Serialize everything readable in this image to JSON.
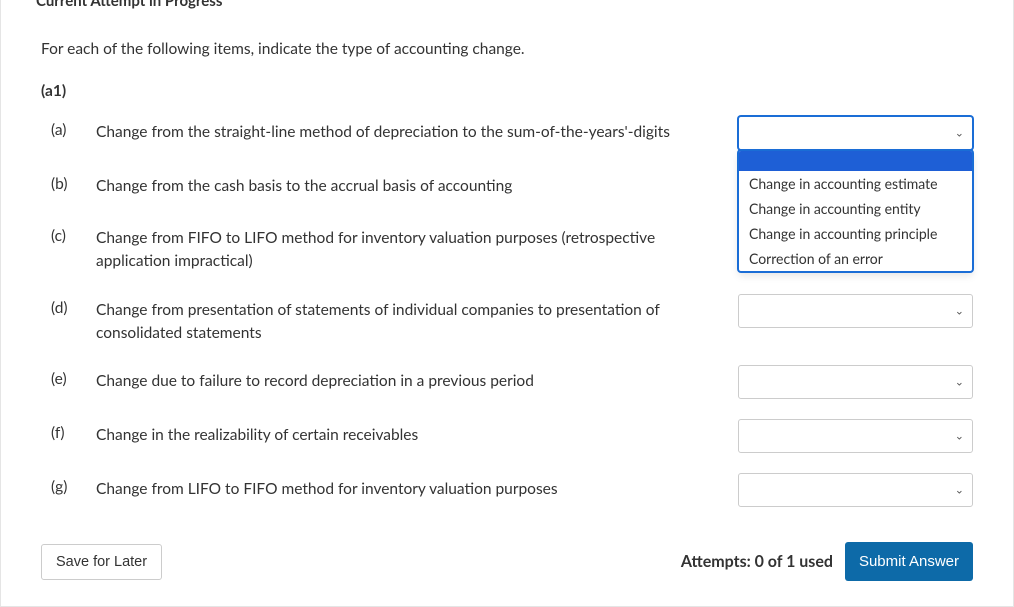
{
  "top_title": "Current Attempt in Progress",
  "instruction": "For each of the following items, indicate the type of accounting change.",
  "part_label": "(a1)",
  "items": [
    {
      "label": "(a)",
      "text": "Change from the straight-line method of depreciation to the sum-of-the-years'-digits",
      "dropdown_open": true
    },
    {
      "label": "(b)",
      "text": "Change from the cash basis to the accrual basis of accounting",
      "dropdown_open": false,
      "hide_select": true
    },
    {
      "label": "(c)",
      "text": "Change from FIFO to LIFO method for inventory valuation purposes (retrospective application impractical)",
      "dropdown_open": false,
      "hide_select": true
    },
    {
      "label": "(d)",
      "text": "Change from presentation of statements of individual companies to presentation of consolidated statements",
      "dropdown_open": false
    },
    {
      "label": "(e)",
      "text": "Change due to failure to record depreciation in a previous period",
      "dropdown_open": false
    },
    {
      "label": "(f)",
      "text": "Change in the realizability of certain receivables",
      "dropdown_open": false
    },
    {
      "label": "(g)",
      "text": "Change from LIFO to FIFO method for inventory valuation purposes",
      "dropdown_open": false
    }
  ],
  "dropdown_options": [
    "",
    "Change in accounting estimate",
    "Change in accounting entity",
    "Change in accounting principle",
    "Correction of an error"
  ],
  "footer": {
    "save_label": "Save for Later",
    "attempts_text": "Attempts: 0 of 1 used",
    "submit_label": "Submit Answer"
  }
}
